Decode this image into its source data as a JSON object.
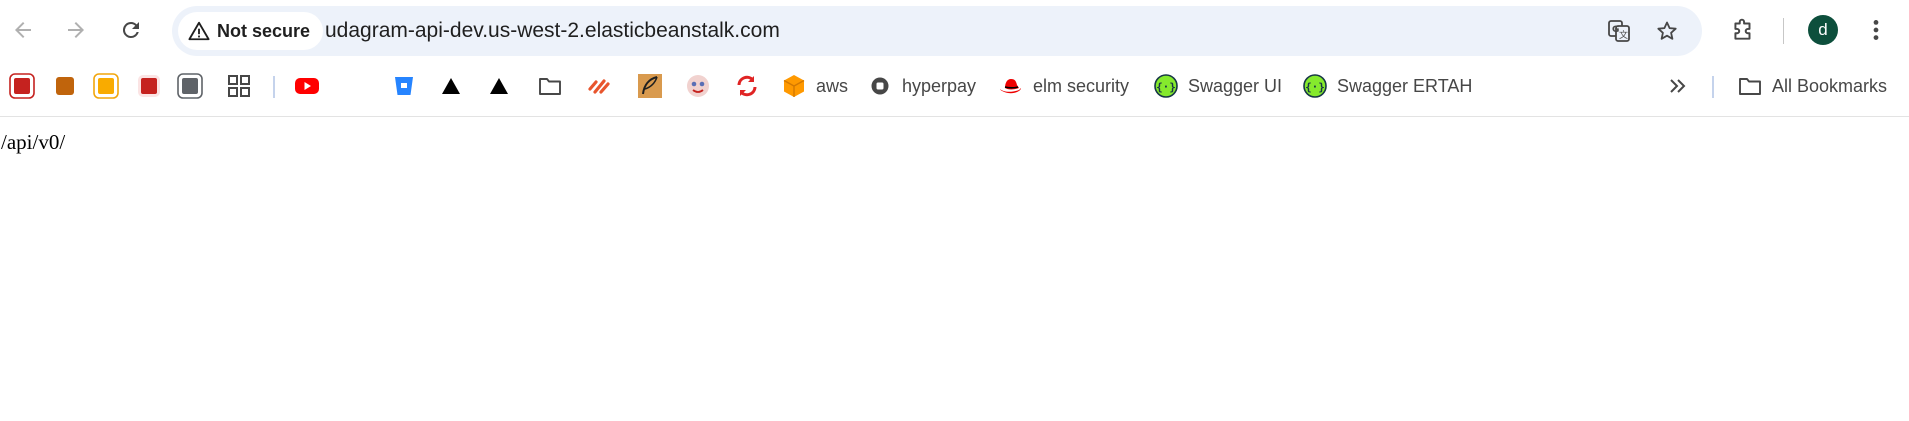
{
  "toolbar": {
    "back_icon": "arrow-left-icon",
    "forward_icon": "arrow-right-icon",
    "reload_icon": "reload-icon"
  },
  "omnibox": {
    "security_label": "Not secure",
    "security_icon": "warning-triangle-icon",
    "url": "udagram-api-dev.us-west-2.elasticbeanstalk.com",
    "translate_icon": "translate-icon",
    "bookmark_icon": "star-icon"
  },
  "profile": {
    "initial": "d",
    "color": "#0d4f3c"
  },
  "bookmarks": [
    {
      "label": "",
      "icon": "red-square-icon"
    },
    {
      "label": "",
      "icon": "orange-square-icon"
    },
    {
      "label": "",
      "icon": "yellow-square-icon"
    },
    {
      "label": "",
      "icon": "crimson-square-icon"
    },
    {
      "label": "",
      "icon": "gray-square-icon"
    },
    {
      "label": "",
      "icon": "apps-grid-icon"
    },
    {
      "label": "",
      "icon": "youtube-icon"
    },
    {
      "label": "",
      "icon": "bitbucket-icon"
    },
    {
      "label": "",
      "icon": "black-triangle-icon"
    },
    {
      "label": "",
      "icon": "black-triangle-icon"
    },
    {
      "label": "",
      "icon": "folder-icon"
    },
    {
      "label": "",
      "icon": "stripes-icon"
    },
    {
      "label": "",
      "icon": "feather-icon"
    },
    {
      "label": "",
      "icon": "face-icon"
    },
    {
      "label": "",
      "icon": "sync-arrows-icon"
    },
    {
      "label": "aws",
      "icon": "aws-cube-icon"
    },
    {
      "label": "hyperpay",
      "icon": "ring-icon"
    },
    {
      "label": "elm security",
      "icon": "redhat-icon"
    },
    {
      "label": "Swagger UI",
      "icon": "swagger-icon"
    },
    {
      "label": "Swagger ERTAH",
      "icon": "swagger-icon"
    }
  ],
  "bookmarks_overflow_icon": "double-chevron-icon",
  "all_bookmarks": {
    "label": "All Bookmarks",
    "icon": "folder-icon"
  },
  "page": {
    "text": "/api/v0/"
  }
}
